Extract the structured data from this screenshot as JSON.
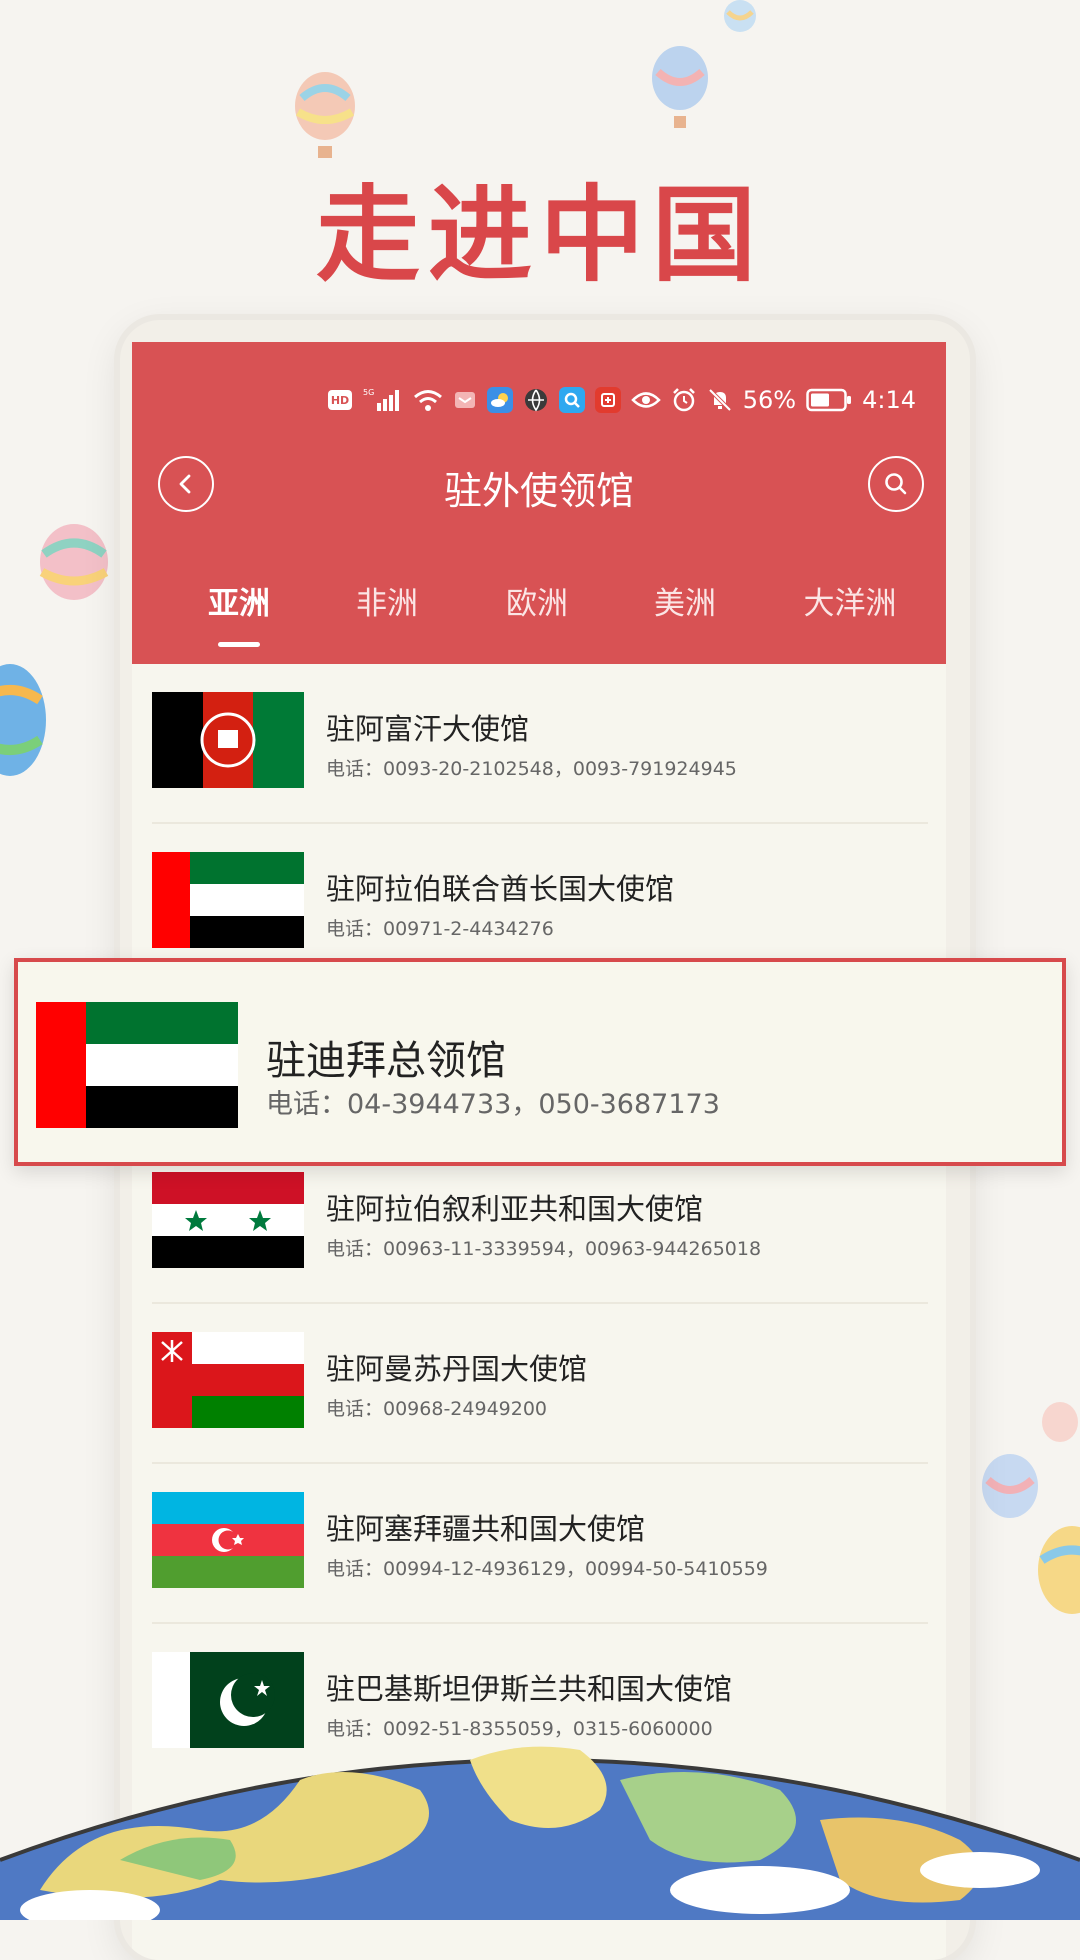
{
  "promo": {
    "title": "走进中国"
  },
  "status_bar": {
    "hd": "HD",
    "network": "5G",
    "battery": "56%",
    "time": "4:14",
    "icons": [
      "hd-icon",
      "signal-icon",
      "wifi-icon",
      "huawei-share-icon",
      "weather-app-icon",
      "browser-app-icon",
      "search-app-icon",
      "taobao-app-icon",
      "eye-icon",
      "alarm-icon",
      "mute-icon",
      "battery-icon"
    ]
  },
  "header": {
    "title": "驻外使领馆",
    "back_icon": "back-circle-icon",
    "search_icon": "search-circle-icon"
  },
  "tabs": [
    {
      "label": "亚洲",
      "active": true
    },
    {
      "label": "非洲",
      "active": false
    },
    {
      "label": "欧洲",
      "active": false
    },
    {
      "label": "美洲",
      "active": false
    },
    {
      "label": "大洋洲",
      "active": false
    }
  ],
  "embassies": [
    {
      "name": "驻阿富汗大使馆",
      "phone": "电话：0093-20-2102548，0093-791924945",
      "flag": "afghanistan-flag"
    },
    {
      "name": "驻阿拉伯联合酋长国大使馆",
      "phone": "电话：00971-2-4434276",
      "flag": "uae-flag"
    },
    {
      "name": "驻迪拜总领馆",
      "phone": "电话：04-3944733，050-3687173",
      "flag": "uae-flag"
    },
    {
      "name": "驻阿拉伯叙利亚共和国大使馆",
      "phone": "电话：00963-11-3339594，00963-944265018",
      "flag": "syria-flag"
    },
    {
      "name": "驻阿曼苏丹国大使馆",
      "phone": "电话：00968-24949200",
      "flag": "oman-flag"
    },
    {
      "name": "驻阿塞拜疆共和国大使馆",
      "phone": "电话：00994-12-4936129，00994-50-5410559",
      "flag": "azerbaijan-flag"
    },
    {
      "name": "驻巴基斯坦伊斯兰共和国大使馆",
      "phone": "电话：0092-51-8355059，0315-6060000",
      "flag": "pakistan-flag"
    }
  ],
  "highlight_index": 2,
  "colors": {
    "brand_red": "#d85254",
    "title_red": "#d9474a",
    "list_bg": "#f7f6ee",
    "page_bg": "#f6f4f0"
  }
}
